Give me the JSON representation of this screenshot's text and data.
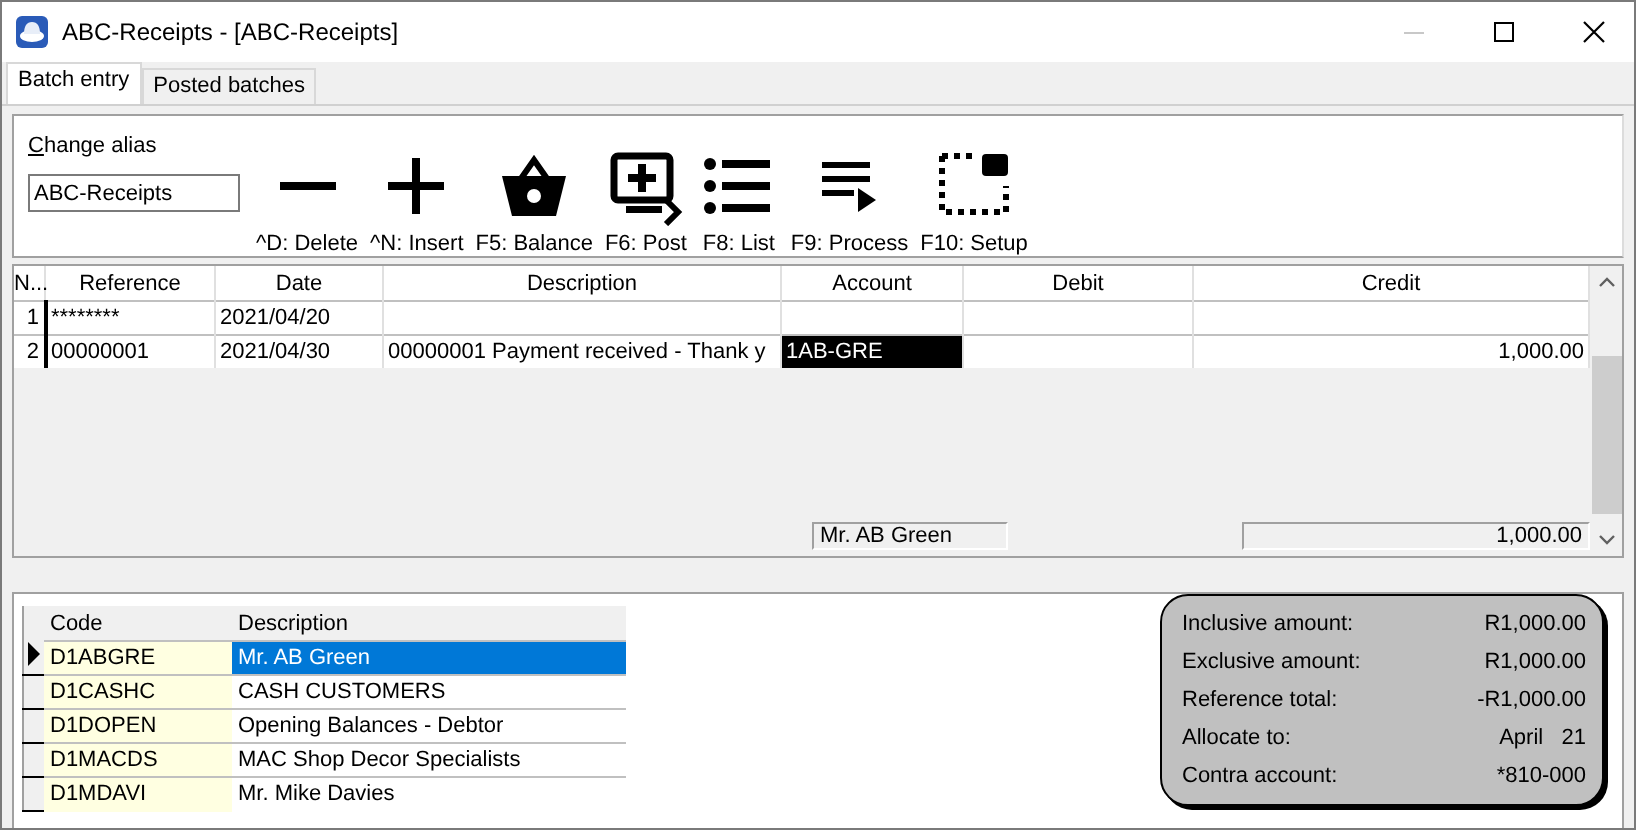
{
  "window": {
    "title": "ABC-Receipts - [ABC-Receipts]"
  },
  "tabs": [
    {
      "label": "Batch entry",
      "selected": true
    },
    {
      "label": "Posted batches",
      "selected": false
    }
  ],
  "alias": {
    "label": "Change alias",
    "value": "ABC-Receipts"
  },
  "toolbar": [
    {
      "kind": "minus",
      "label": "^D: Delete"
    },
    {
      "kind": "plus",
      "label": "^N: Insert"
    },
    {
      "kind": "basket",
      "label": "F5: Balance"
    },
    {
      "kind": "monitor",
      "label": "F6: Post"
    },
    {
      "kind": "list",
      "label": "F8: List"
    },
    {
      "kind": "process",
      "label": "F9: Process"
    },
    {
      "kind": "setup",
      "label": "F10: Setup"
    }
  ],
  "table": {
    "columns": [
      "N...",
      "Reference",
      "Date",
      "Description",
      "Account",
      "Debit",
      "Credit"
    ],
    "rows": [
      {
        "cells": [
          {
            "text": "1",
            "selected": false
          },
          {
            "text": "********",
            "selected": false
          },
          {
            "text": "2021/04/20",
            "selected": false
          },
          {
            "text": "",
            "selected": false
          },
          {
            "text": "",
            "selected": false
          },
          {
            "text": "",
            "selected": false
          },
          {
            "text": "",
            "selected": false
          }
        ]
      },
      {
        "cells": [
          {
            "text": "2",
            "selected": false
          },
          {
            "text": "00000001",
            "selected": false
          },
          {
            "text": "2021/04/30",
            "selected": false
          },
          {
            "text": "00000001 Payment received - Thank y",
            "selected": false
          },
          {
            "text": "1AB-GRE",
            "selected": true
          },
          {
            "text": "",
            "selected": false
          },
          {
            "text": "1,000.00",
            "selected": false
          }
        ]
      }
    ],
    "footer": {
      "account_name": "Mr. AB Green",
      "credit_total": "1,000.00"
    }
  },
  "lookup": {
    "columns": [
      "Code",
      "Description"
    ],
    "rows": [
      {
        "code": "D1ABGRE",
        "description": "Mr. AB Green",
        "selected": true
      },
      {
        "code": "D1CASHC",
        "description": "CASH CUSTOMERS",
        "selected": false
      },
      {
        "code": "D1DOPEN",
        "description": "Opening Balances - Debtor",
        "selected": false
      },
      {
        "code": "D1MACDS",
        "description": "MAC Shop Decor Specialists",
        "selected": false
      },
      {
        "code": "D1MDAVI",
        "description": "Mr. Mike Davies",
        "selected": false
      }
    ]
  },
  "summary": [
    {
      "label": "Inclusive amount:",
      "value": "R1,000.00"
    },
    {
      "label": "Exclusive amount:",
      "value": "R1,000.00"
    },
    {
      "label": "Reference total:",
      "value": "-R1,000.00"
    },
    {
      "label": "Allocate to:",
      "value": "April   21"
    },
    {
      "label": "Contra account:",
      "value": "*810-000"
    }
  ]
}
